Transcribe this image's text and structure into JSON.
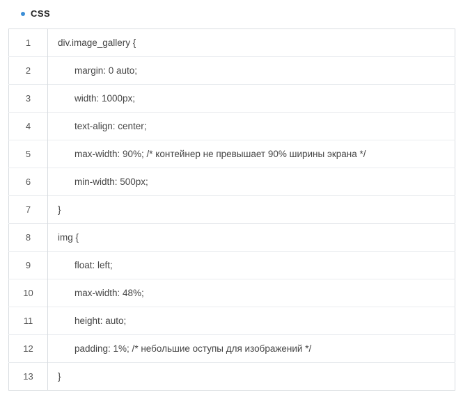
{
  "header": {
    "title": "CSS"
  },
  "code": {
    "lines": [
      {
        "n": "1",
        "text": "div.image_gallery {",
        "indent": 1
      },
      {
        "n": "2",
        "text": "margin: 0 auto;",
        "indent": 2
      },
      {
        "n": "3",
        "text": "width: 1000px;",
        "indent": 2
      },
      {
        "n": "4",
        "text": "text-align: center;",
        "indent": 2
      },
      {
        "n": "5",
        "text": "max-width: 90%; /* контейнер не превышает 90% ширины экрана */",
        "indent": 2
      },
      {
        "n": "6",
        "text": "min-width: 500px;",
        "indent": 2
      },
      {
        "n": "7",
        "text": "}",
        "indent": 1
      },
      {
        "n": "8",
        "text": "img {",
        "indent": 1
      },
      {
        "n": "9",
        "text": "float: left;",
        "indent": 2
      },
      {
        "n": "10",
        "text": "max-width: 48%;",
        "indent": 2
      },
      {
        "n": "11",
        "text": "height: auto;",
        "indent": 2
      },
      {
        "n": "12",
        "text": "padding: 1%; /* небольшие оступы для изображений */",
        "indent": 2
      },
      {
        "n": "13",
        "text": "}",
        "indent": 1
      }
    ]
  }
}
